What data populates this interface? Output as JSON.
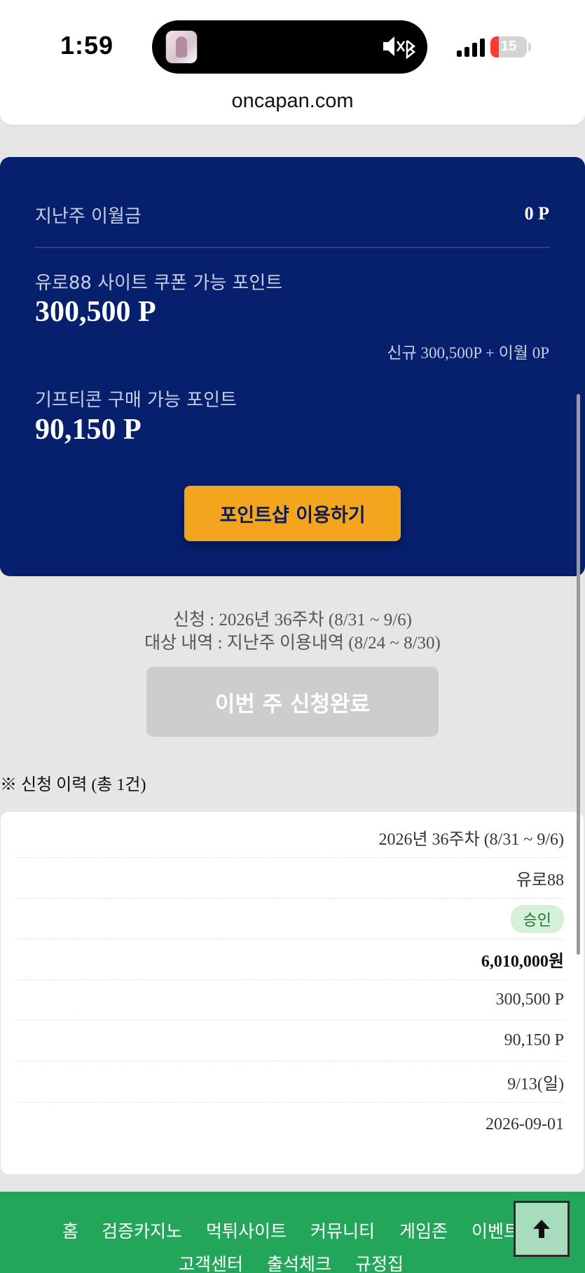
{
  "status": {
    "time": "1:59",
    "battery": "15"
  },
  "browser": {
    "url": "oncapan.com"
  },
  "points": {
    "carryover_label": "지난주 이월금",
    "carryover_value": "0 P",
    "coupon_label": "유로88 사이트 쿠폰 가능 포인트",
    "coupon_value": "300,500 P",
    "coupon_breakdown": "신규 300,500P + 이월 0P",
    "gifticon_label": "기프티콘 구매 가능 포인트",
    "gifticon_value": "90,150 P",
    "shop_button": "포인트샵 이용하기"
  },
  "application": {
    "period": "신청 : 2026년 36주차 (8/31 ~ 9/6)",
    "target": "대상 내역 : 지난주 이용내역 (8/24 ~ 8/30)",
    "done_button": "이번 주 신청완료"
  },
  "history": {
    "title": "※ 신청 이력 (총 1건)",
    "record": {
      "week": "2026년 36주차 (8/31 ~ 9/6)",
      "site": "유로88",
      "status": "승인",
      "amount": "6,010,000원",
      "coupon_points": "300,500 P",
      "gifticon_points": "90,150 P",
      "payout_date": "9/13(일)",
      "applied_date": "2026-09-01"
    }
  },
  "footer": {
    "nav": [
      "홈",
      "검증카지노",
      "먹튀사이트",
      "커뮤니티",
      "게임존",
      "이벤트",
      "고객센터",
      "출석체크",
      "규정집"
    ]
  },
  "colors": {
    "navy": "#06206e",
    "accent": "#f3a51e",
    "footer_green": "#23a55a",
    "approved_green": "#1f7a35"
  }
}
